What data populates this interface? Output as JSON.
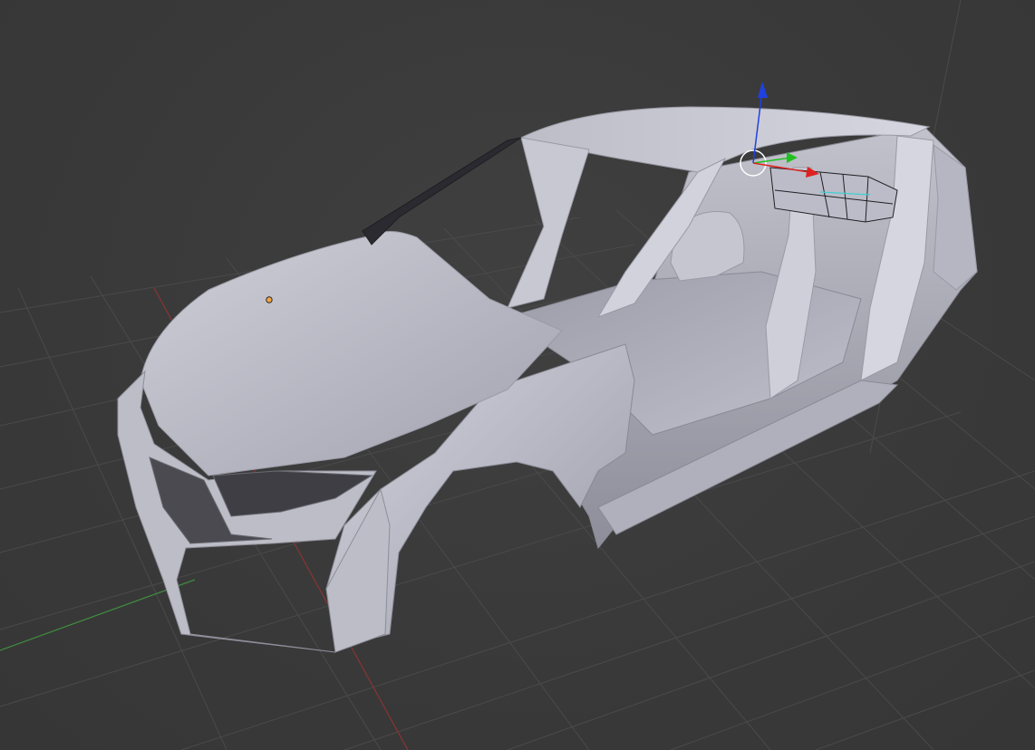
{
  "app": {
    "name": "3D viewport",
    "background_color": "#393939"
  },
  "viewport": {
    "view": "perspective",
    "shading": "solid",
    "grid_visible": true,
    "grid_color": "#4a4a4a",
    "axis_x_color": "#8a3434",
    "axis_y_color": "#3f8a3f"
  },
  "scene": {
    "object": {
      "type": "car-body-mesh",
      "color": "#c8c8d2",
      "selected_part_mode": "edit-mesh"
    },
    "origin_marker_color": "#f2a640",
    "gizmo": {
      "mode": "translate",
      "x_color": "#e02020",
      "y_color": "#20c020",
      "z_color": "#2040e0"
    }
  }
}
